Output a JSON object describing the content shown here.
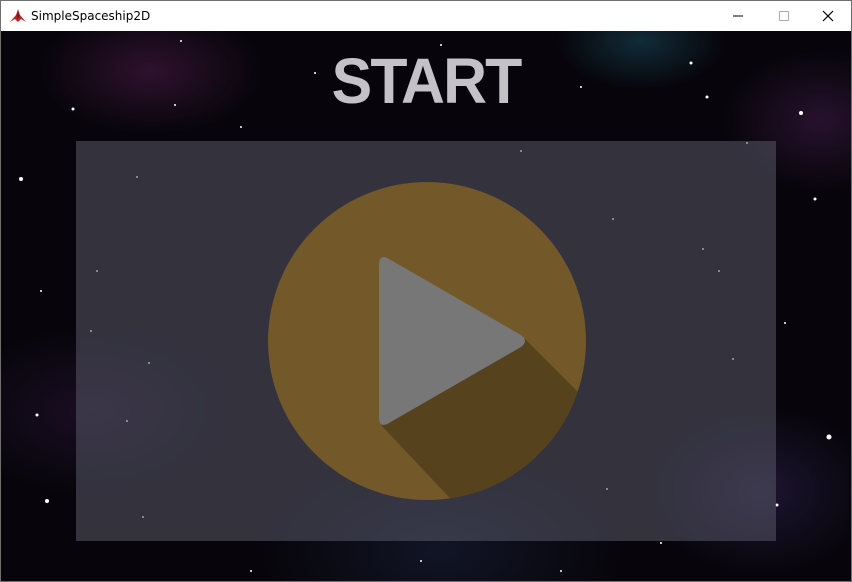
{
  "window": {
    "title": "SimpleSpaceship2D",
    "controls": {
      "minimize_icon": "minimize-icon",
      "maximize_icon": "maximize-icon",
      "close_icon": "close-icon"
    }
  },
  "game": {
    "heading": "START",
    "play_icon": "play-icon",
    "colors": {
      "heading": "#c4c1c7",
      "play_circle": "#735829",
      "play_shadow": "#57421e",
      "play_triangle": "#777777",
      "panel": "#3a3a46"
    }
  }
}
